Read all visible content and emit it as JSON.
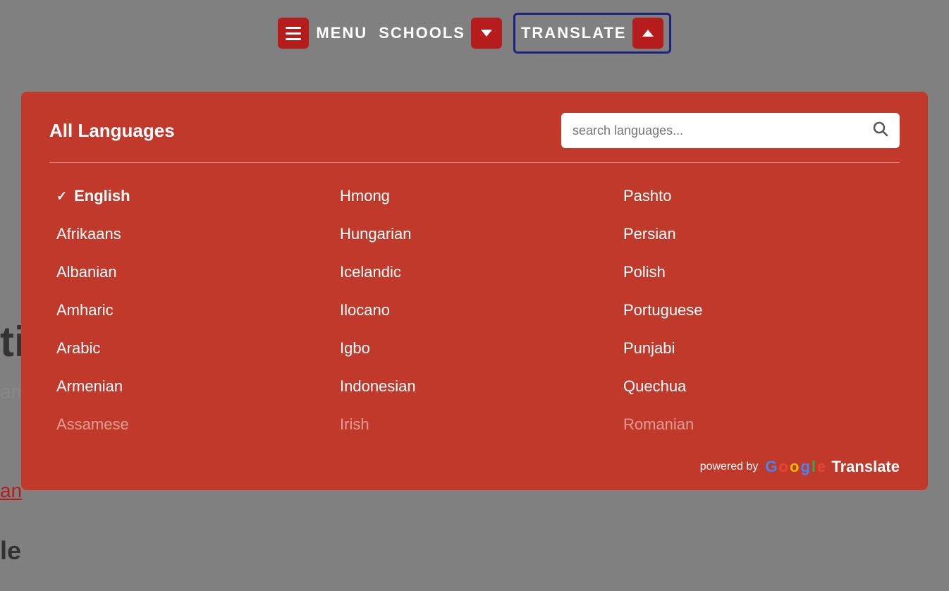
{
  "header": {
    "menu_label": "MENU",
    "schools_label": "SCHOOLS",
    "translate_label": "TRANSLATE"
  },
  "dropdown": {
    "title": "All Languages",
    "search_placeholder": "search languages...",
    "powered_by": "powered by",
    "google_translate": "Google Translate",
    "languages_col1": [
      {
        "id": "english",
        "label": "English",
        "selected": true
      },
      {
        "id": "afrikaans",
        "label": "Afrikaans",
        "selected": false
      },
      {
        "id": "albanian",
        "label": "Albanian",
        "selected": false
      },
      {
        "id": "amharic",
        "label": "Amharic",
        "selected": false
      },
      {
        "id": "arabic",
        "label": "Arabic",
        "selected": false
      },
      {
        "id": "armenian",
        "label": "Armenian",
        "selected": false
      },
      {
        "id": "assamese",
        "label": "Assamese",
        "selected": false,
        "faded": true
      }
    ],
    "languages_col2": [
      {
        "id": "hmong",
        "label": "Hmong",
        "selected": false
      },
      {
        "id": "hungarian",
        "label": "Hungarian",
        "selected": false
      },
      {
        "id": "icelandic",
        "label": "Icelandic",
        "selected": false
      },
      {
        "id": "ilocano",
        "label": "Ilocano",
        "selected": false
      },
      {
        "id": "igbo",
        "label": "Igbo",
        "selected": false
      },
      {
        "id": "indonesian",
        "label": "Indonesian",
        "selected": false
      },
      {
        "id": "irish",
        "label": "Irish",
        "selected": false,
        "faded": true
      }
    ],
    "languages_col3": [
      {
        "id": "pashto",
        "label": "Pashto",
        "selected": false
      },
      {
        "id": "persian",
        "label": "Persian",
        "selected": false
      },
      {
        "id": "polish",
        "label": "Polish",
        "selected": false
      },
      {
        "id": "portuguese",
        "label": "Portuguese",
        "selected": false
      },
      {
        "id": "punjabi",
        "label": "Punjabi",
        "selected": false
      },
      {
        "id": "quechua",
        "label": "Quechua",
        "selected": false
      },
      {
        "id": "romanian",
        "label": "Romanian",
        "selected": false,
        "faded": true
      }
    ]
  }
}
